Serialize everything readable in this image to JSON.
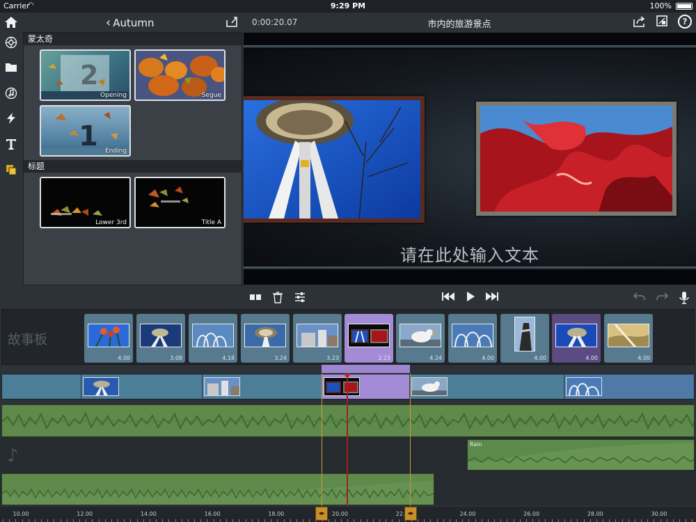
{
  "status": {
    "carrier": "Carrier",
    "time": "9:29 PM",
    "battery": "100%"
  },
  "rail": {
    "icons": [
      "home-icon",
      "montage-icon",
      "folder-icon",
      "music-icon",
      "lightning-icon",
      "text-icon",
      "layers-icon"
    ]
  },
  "header": {
    "back_label": "Autumn",
    "timecode": "0:00:20.07",
    "project_title": "市内的旅游景点"
  },
  "library": {
    "sections": [
      {
        "title": "蒙太奇",
        "items": [
          "Opening",
          "Segue",
          "Ending"
        ]
      },
      {
        "title": "标题",
        "items": [
          "Lower 3rd",
          "Title A"
        ]
      }
    ]
  },
  "preview": {
    "caption": "请在此处输入文本"
  },
  "storyboard": {
    "label": "故事板",
    "clips": [
      {
        "duration": "4.00",
        "state": "normal"
      },
      {
        "duration": "3.08",
        "state": "normal"
      },
      {
        "duration": "4.18",
        "state": "normal"
      },
      {
        "duration": "3.24",
        "state": "normal"
      },
      {
        "duration": "3.23",
        "state": "normal"
      },
      {
        "duration": "2.23",
        "state": "selected"
      },
      {
        "duration": "4.24",
        "state": "normal"
      },
      {
        "duration": "4.00",
        "state": "normal"
      },
      {
        "duration": "4.00",
        "state": "normal"
      },
      {
        "duration": "4.00",
        "state": "purple"
      },
      {
        "duration": "4.00",
        "state": "normal"
      }
    ]
  },
  "timeline": {
    "rain_label": "Rain",
    "ruler": [
      "10.00",
      "12.00",
      "14.00",
      "16.00",
      "18.00",
      "20.00",
      "22.00",
      "24.00",
      "26.00",
      "28.00",
      "30.00"
    ]
  },
  "colors": {
    "clip": "#577a8e",
    "selected": "#a38bd6",
    "audio": "#5f8a4c",
    "playhead": "#a02020",
    "trim": "#c8902a"
  }
}
